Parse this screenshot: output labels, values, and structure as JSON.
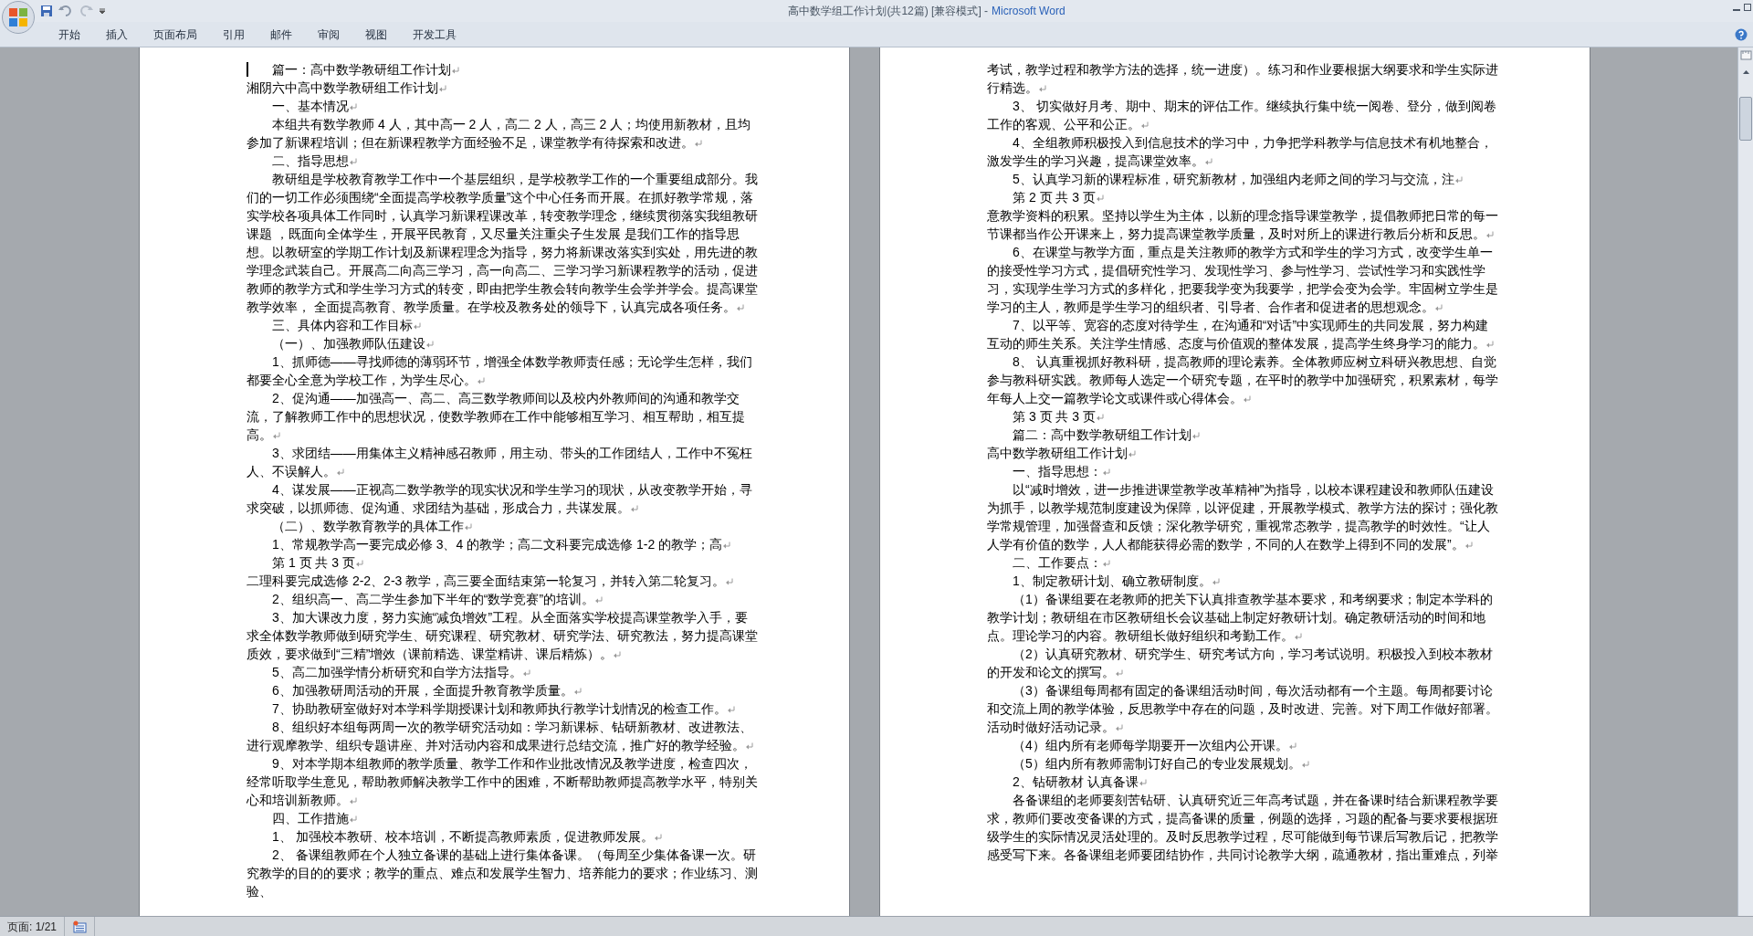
{
  "window": {
    "title": "高中数学组工作计划(共12篇) [兼容模式] -",
    "app_name": "Microsoft Word"
  },
  "ribbon_tabs": [
    "开始",
    "插入",
    "页面布局",
    "引用",
    "邮件",
    "审阅",
    "视图",
    "开发工具"
  ],
  "pages": [
    {
      "paragraphs": [
        {
          "text": "篇一：高中数学教研组工作计划",
          "indent": true,
          "mark": true,
          "cursor": true
        },
        {
          "text": "湘阴六中高中数学教研组工作计划",
          "indent": false,
          "mark": true,
          "cursor": false
        },
        {
          "text": "一、基本情况",
          "indent": true,
          "mark": true,
          "cursor": false
        },
        {
          "text": "本组共有数学教师 4 人，其中高一 2 人，高二 2 人，高三 2 人；均使用新教材，且均参加了新课程培训；但在新课程教学方面经验不足，课堂教学有待探索和改进。",
          "indent": true,
          "mark": true,
          "cursor": false
        },
        {
          "text": "二、指导思想",
          "indent": true,
          "mark": true,
          "cursor": false
        },
        {
          "text": "教研组是学校教育教学工作中一个基层组织，是学校教学工作的一个重要组成部分。我们的一切工作必须围绕“全面提高学校教学质量”这个中心任务而开展。在抓好教学常规，落实学校各项具体工作同时，认真学习新课程课改革，转变教学理念，继续贯彻落实我组教研课题 ，既面向全体学生，开展平民教育，又尽量关注重尖子生发展 是我们工作的指导思想。以教研室的学期工作计划及新课程理念为指导，努力将新课改落实到实处，用先进的教学理念武装自己。开展高二向高三学习，高一向高二、三学习学习新课程教学的活动，促进教师的教学方式和学生学习方式的转变，即由把学生教会转向教学生会学并学会。提高课堂教学效率， 全面提高教育、教学质量。在学校及教务处的领导下，认真完成各项任务。",
          "indent": true,
          "mark": true,
          "cursor": false
        },
        {
          "text": "三、具体内容和工作目标",
          "indent": true,
          "mark": true,
          "cursor": false
        },
        {
          "text": "（一）、加强教师队伍建设",
          "indent": true,
          "mark": true,
          "cursor": false
        },
        {
          "text": "1、抓师德——寻找师德的薄弱环节，增强全体数学教师责任感；无论学生怎样，我们都要全心全意为学校工作，为学生尽心。",
          "indent": true,
          "mark": true,
          "cursor": false
        },
        {
          "text": "2、促沟通——加强高一、高二、高三数学教师间以及校内外教师间的沟通和教学交流，了解教师工作中的思想状况，使数学教师在工作中能够相互学习、相互帮助，相互提高。",
          "indent": true,
          "mark": true,
          "cursor": false
        },
        {
          "text": "3、求团结——用集体主义精神感召教师，用主动、带头的工作团结人，工作中不冤枉人、不误解人。",
          "indent": true,
          "mark": true,
          "cursor": false
        },
        {
          "text": "4、谋发展——正视高二数学教学的现实状况和学生学习的现状，从改变教学开始，寻求突破，以抓师德、促沟通、求团结为基础，形成合力，共谋发展。",
          "indent": true,
          "mark": true,
          "cursor": false
        },
        {
          "text": "（二）、数学教育教学的具体工作",
          "indent": true,
          "mark": true,
          "cursor": false
        },
        {
          "text": "1、常规教学高一要完成必修 3、4 的教学；高二文科要完成选修 1-2 的教学；高",
          "indent": true,
          "mark": true,
          "cursor": false
        },
        {
          "text": "第 1 页 共 3 页",
          "indent": true,
          "mark": true,
          "cursor": false
        },
        {
          "text": "二理科要完成选修 2-2、2-3 教学，高三要全面结束第一轮复习，并转入第二轮复习。",
          "indent": false,
          "mark": true,
          "cursor": false
        },
        {
          "text": "2、组织高一、高二学生参加下半年的“数学竞赛”的培训。",
          "indent": true,
          "mark": true,
          "cursor": false
        },
        {
          "text": "3、加大课改力度，努力实施“减负增效”工程。从全面落实学校提高课堂教学入手，要求全体数学教师做到研究学生、研究课程、研究教材、研究学法、研究教法，努力提高课堂质效，要求做到“三精”增效（课前精选、课堂精讲、课后精炼）。",
          "indent": true,
          "mark": true,
          "cursor": false
        },
        {
          "text": "5、高二加强学情分析研究和自学方法指导。",
          "indent": true,
          "mark": true,
          "cursor": false
        },
        {
          "text": "6、加强教研周活动的开展，全面提升教育教学质量。",
          "indent": true,
          "mark": true,
          "cursor": false
        },
        {
          "text": "7、协助教研室做好对本学科学期授课计划和教师执行教学计划情况的检查工作。",
          "indent": true,
          "mark": true,
          "cursor": false
        },
        {
          "text": "8、组织好本组每两周一次的教学研究活动如：学习新课标、钻研新教材、改进教法、进行观摩教学、组织专题讲座、并对活动内容和成果进行总结交流，推广好的教学经验。",
          "indent": true,
          "mark": true,
          "cursor": false
        },
        {
          "text": "9、对本学期本组教师的教学质量、教学工作和作业批改情况及教学进度，检查四次，经常听取学生意见，帮助教师解决教学工作中的困难，不断帮助教师提高教学水平，特别关心和培训新教师。",
          "indent": true,
          "mark": true,
          "cursor": false
        },
        {
          "text": "四、工作措施",
          "indent": true,
          "mark": true,
          "cursor": false
        },
        {
          "text": "1、 加强校本教研、校本培训，不断提高教师素质，促进教师发展。",
          "indent": true,
          "mark": true,
          "cursor": false
        },
        {
          "text": "2、 备课组教师在个人独立备课的基础上进行集体备课。（每周至少集体备课一次。研究教学的目的的要求；教学的重点、难点和发展学生智力、培养能力的要求；作业练习、测验、",
          "indent": true,
          "mark": false,
          "cursor": false
        }
      ]
    },
    {
      "paragraphs": [
        {
          "text": "考试，教学过程和教学方法的选择，统一进度）。练习和作业要根据大纲要求和学生实际进行精选。",
          "indent": false,
          "mark": true,
          "cursor": false
        },
        {
          "text": "3、 切实做好月考、期中、期末的评估工作。继续执行集中统一阅卷、登分，做到阅卷工作的客观、公平和公正。",
          "indent": true,
          "mark": true,
          "cursor": false
        },
        {
          "text": "4、全组教师积极投入到信息技术的学习中，力争把学科教学与信息技术有机地整合，激发学生的学习兴趣，提高课堂效率。",
          "indent": true,
          "mark": true,
          "cursor": false
        },
        {
          "text": "5、认真学习新的课程标准，研究新教材，加强组内老师之间的学习与交流，注",
          "indent": true,
          "mark": true,
          "cursor": false
        },
        {
          "text": "第 2 页 共 3 页",
          "indent": true,
          "mark": true,
          "cursor": false
        },
        {
          "text": "意教学资料的积累。坚持以学生为主体，以新的理念指导课堂教学，提倡教师把日常的每一节课都当作公开课来上，努力提高课堂教学质量，及时对所上的课进行教后分析和反思。",
          "indent": false,
          "mark": true,
          "cursor": false
        },
        {
          "text": "6、在课堂与教学方面，重点是关注教师的教学方式和学生的学习方式，改变学生单一的接受性学习方式，提倡研究性学习、发现性学习、参与性学习、尝试性学习和实践性学习，实现学生学习方式的多样化，把要我学变为我要学，把学会变为会学。牢固树立学生是学习的主人，教师是学生学习的组织者、引导者、合作者和促进者的思想观念。",
          "indent": true,
          "mark": true,
          "cursor": false
        },
        {
          "text": "7、以平等、宽容的态度对待学生，在沟通和“对话”中实现师生的共同发展，努力构建互动的师生关系。关注学生情感、态度与价值观的整体发展，提高学生终身学习的能力。",
          "indent": true,
          "mark": true,
          "cursor": false
        },
        {
          "text": "8、 认真重视抓好教科研，提高教师的理论素养。全体教师应树立科研兴教思想、自觉参与教科研实践。教师每人选定一个研究专题，在平时的教学中加强研究，积累素材，每学年每人上交一篇教学论文或课件或心得体会。",
          "indent": true,
          "mark": true,
          "cursor": false
        },
        {
          "text": "第 3 页 共 3 页",
          "indent": true,
          "mark": true,
          "cursor": false
        },
        {
          "text": "篇二：高中数学教研组工作计划",
          "indent": true,
          "mark": true,
          "cursor": false
        },
        {
          "text": "高中数学教研组工作计划",
          "indent": false,
          "mark": true,
          "cursor": false
        },
        {
          "text": "一、指导思想：",
          "indent": true,
          "mark": true,
          "cursor": false
        },
        {
          "text": "以“减时增效，进一步推进课堂教学改革精神”为指导，以校本课程建设和教师队伍建设为抓手，以教学规范制度建设为保障，以评促建，开展教学模式、教学方法的探讨；强化教学常规管理，加强督查和反馈；深化教学研究，重视常态教学，提高教学的时效性。“让人人学有价值的数学，人人都能获得必需的数学，不同的人在数学上得到不同的发展”。",
          "indent": true,
          "mark": true,
          "cursor": false
        },
        {
          "text": "二、工作要点：",
          "indent": true,
          "mark": true,
          "cursor": false
        },
        {
          "text": "1、制定教研计划、确立教研制度。",
          "indent": true,
          "mark": true,
          "cursor": false
        },
        {
          "text": "（1）备课组要在老教师的把关下认真排查教学基本要求，和考纲要求；制定本学科的教学计划；教研组在市区教研组长会议基础上制定好教研计划。确定教研活动的时间和地点。理论学习的内容。教研组长做好组织和考勤工作。",
          "indent": true,
          "mark": true,
          "cursor": false
        },
        {
          "text": "（2）认真研究教材、研究学生、研究考试方向，学习考试说明。积极投入到校本教材的开发和论文的撰写。",
          "indent": true,
          "mark": true,
          "cursor": false
        },
        {
          "text": "（3）备课组每周都有固定的备课组活动时间，每次活动都有一个主题。每周都要讨论和交流上周的教学体验，反思教学中存在的问题，及时改进、完善。对下周工作做好部署。活动时做好活动记录。",
          "indent": true,
          "mark": true,
          "cursor": false
        },
        {
          "text": "（4）组内所有老师每学期要开一次组内公开课。",
          "indent": true,
          "mark": true,
          "cursor": false
        },
        {
          "text": "（5）组内所有教师需制订好自己的专业发展规划。",
          "indent": true,
          "mark": true,
          "cursor": false
        },
        {
          "text": "2、钻研教材 认真备课",
          "indent": true,
          "mark": true,
          "cursor": false
        },
        {
          "text": "各备课组的老师要刻苦钻研、认真研究近三年高考试题，并在备课时结合新课程教学要求，教师们要改变备课的方式，提高备课的质量，例题的选择，习题的配备与要求要根据班级学生的实际情况灵活处理的。及时反思教学过程，尽可能做到每节课后写教后记，把教学感受写下来。各备课组老师要团结协作，共同讨论教学大纲，疏通教材，指出重难点，列举",
          "indent": true,
          "mark": false,
          "cursor": false
        }
      ]
    }
  ],
  "status_bar": {
    "page_indicator": "页面: 1/21"
  }
}
